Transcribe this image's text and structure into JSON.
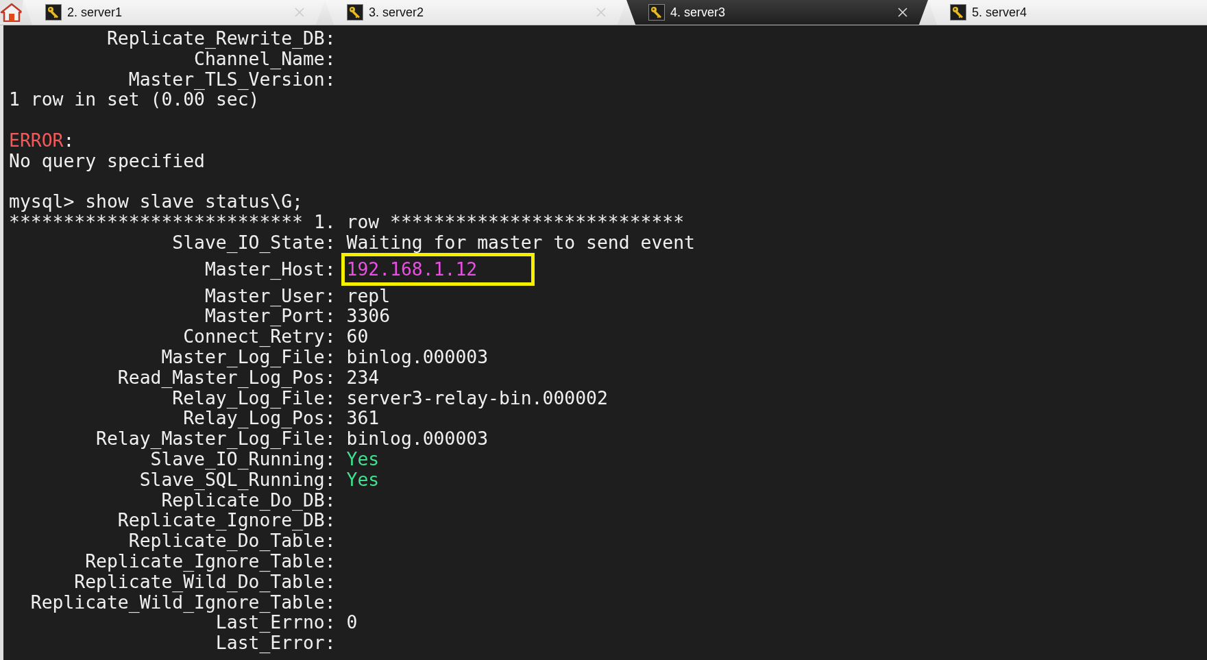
{
  "tabs": [
    {
      "kind": "home",
      "selected": false
    },
    {
      "kind": "session",
      "label": "2. server1",
      "selected": false,
      "closable": true
    },
    {
      "kind": "session",
      "label": "3. server2",
      "selected": false,
      "closable": true
    },
    {
      "kind": "session",
      "label": "4. server3",
      "selected": true,
      "closable": true
    },
    {
      "kind": "session",
      "label": "5. server4",
      "selected": false,
      "closable": false
    }
  ],
  "terminal": {
    "lines": [
      {
        "kind": "field",
        "label": "Replicate_Rewrite_DB:"
      },
      {
        "kind": "field",
        "label": "Channel_Name:"
      },
      {
        "kind": "field",
        "label": "Master_TLS_Version:"
      },
      {
        "kind": "plain",
        "text": "1 row in set (0.00 sec)"
      },
      {
        "kind": "blank"
      },
      {
        "kind": "error",
        "text": "ERROR",
        "rest": ":"
      },
      {
        "kind": "plain",
        "text": "No query specified"
      },
      {
        "kind": "blank"
      },
      {
        "kind": "plain",
        "text": "mysql> show slave status\\G;"
      },
      {
        "kind": "plain",
        "text": "*************************** 1. row ***************************"
      },
      {
        "kind": "field",
        "label": "Slave_IO_State:",
        "value": "Waiting for master to send event"
      },
      {
        "kind": "field",
        "label": "Master_Host:",
        "value": "192.168.1.12",
        "color": "#e94fe3",
        "boxed": true
      },
      {
        "kind": "field",
        "label": "Master_User:",
        "value": "repl"
      },
      {
        "kind": "field",
        "label": "Master_Port:",
        "value": "3306"
      },
      {
        "kind": "field",
        "label": "Connect_Retry:",
        "value": "60"
      },
      {
        "kind": "field",
        "label": "Master_Log_File:",
        "value": "binlog.000003"
      },
      {
        "kind": "field",
        "label": "Read_Master_Log_Pos:",
        "value": "234"
      },
      {
        "kind": "field",
        "label": "Relay_Log_File:",
        "value": "server3-relay-bin.000002"
      },
      {
        "kind": "field",
        "label": "Relay_Log_Pos:",
        "value": "361"
      },
      {
        "kind": "field",
        "label": "Relay_Master_Log_File:",
        "value": "binlog.000003"
      },
      {
        "kind": "field",
        "label": "Slave_IO_Running:",
        "value": "Yes",
        "color": "#3ee08f"
      },
      {
        "kind": "field",
        "label": "Slave_SQL_Running:",
        "value": "Yes",
        "color": "#3ee08f"
      },
      {
        "kind": "field",
        "label": "Replicate_Do_DB:"
      },
      {
        "kind": "field",
        "label": "Replicate_Ignore_DB:"
      },
      {
        "kind": "field",
        "label": "Replicate_Do_Table:"
      },
      {
        "kind": "field",
        "label": "Replicate_Ignore_Table:"
      },
      {
        "kind": "field",
        "label": "Replicate_Wild_Do_Table:"
      },
      {
        "kind": "field",
        "label": "Replicate_Wild_Ignore_Table:"
      },
      {
        "kind": "field",
        "label": "Last_Errno:",
        "value": "0"
      },
      {
        "kind": "field",
        "label": "Last_Error:"
      }
    ]
  }
}
